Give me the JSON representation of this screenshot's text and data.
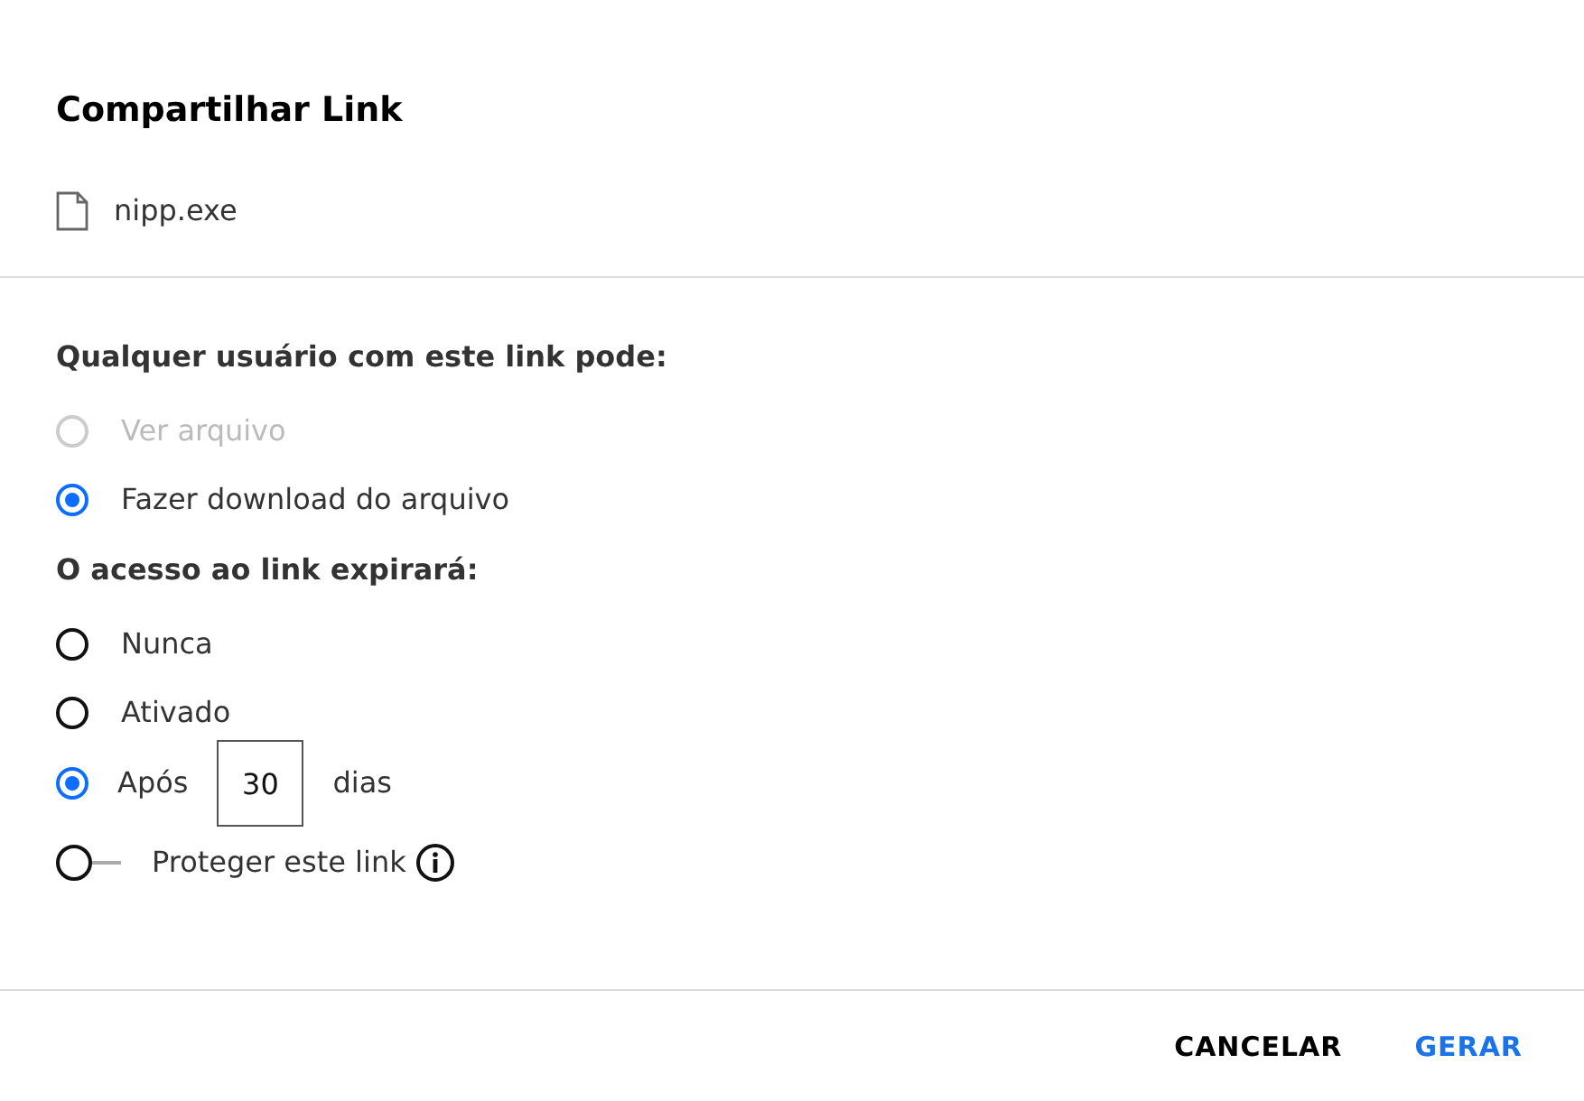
{
  "dialog": {
    "title": "Compartilhar Link",
    "file": {
      "name": "nipp.exe"
    }
  },
  "permission": {
    "label": "Qualquer usuário com este link pode:",
    "options": [
      {
        "label": "Ver arquivo",
        "selected": false,
        "disabled": true
      },
      {
        "label": "Fazer download do arquivo",
        "selected": true,
        "disabled": false
      }
    ]
  },
  "expiry": {
    "label": "O acesso ao link expirará:",
    "options": [
      {
        "kind": "plain",
        "label": "Nunca",
        "selected": false
      },
      {
        "kind": "plain",
        "label": "Ativado",
        "selected": false
      },
      {
        "kind": "days",
        "label": "Após",
        "value": "30",
        "suffix": "dias",
        "selected": true
      }
    ]
  },
  "protect": {
    "label": "Proteger este link",
    "on": false
  },
  "buttons": [
    {
      "label": "CANCELAR",
      "kind": "secondary"
    },
    {
      "label": "GERAR",
      "kind": "primary"
    }
  ]
}
